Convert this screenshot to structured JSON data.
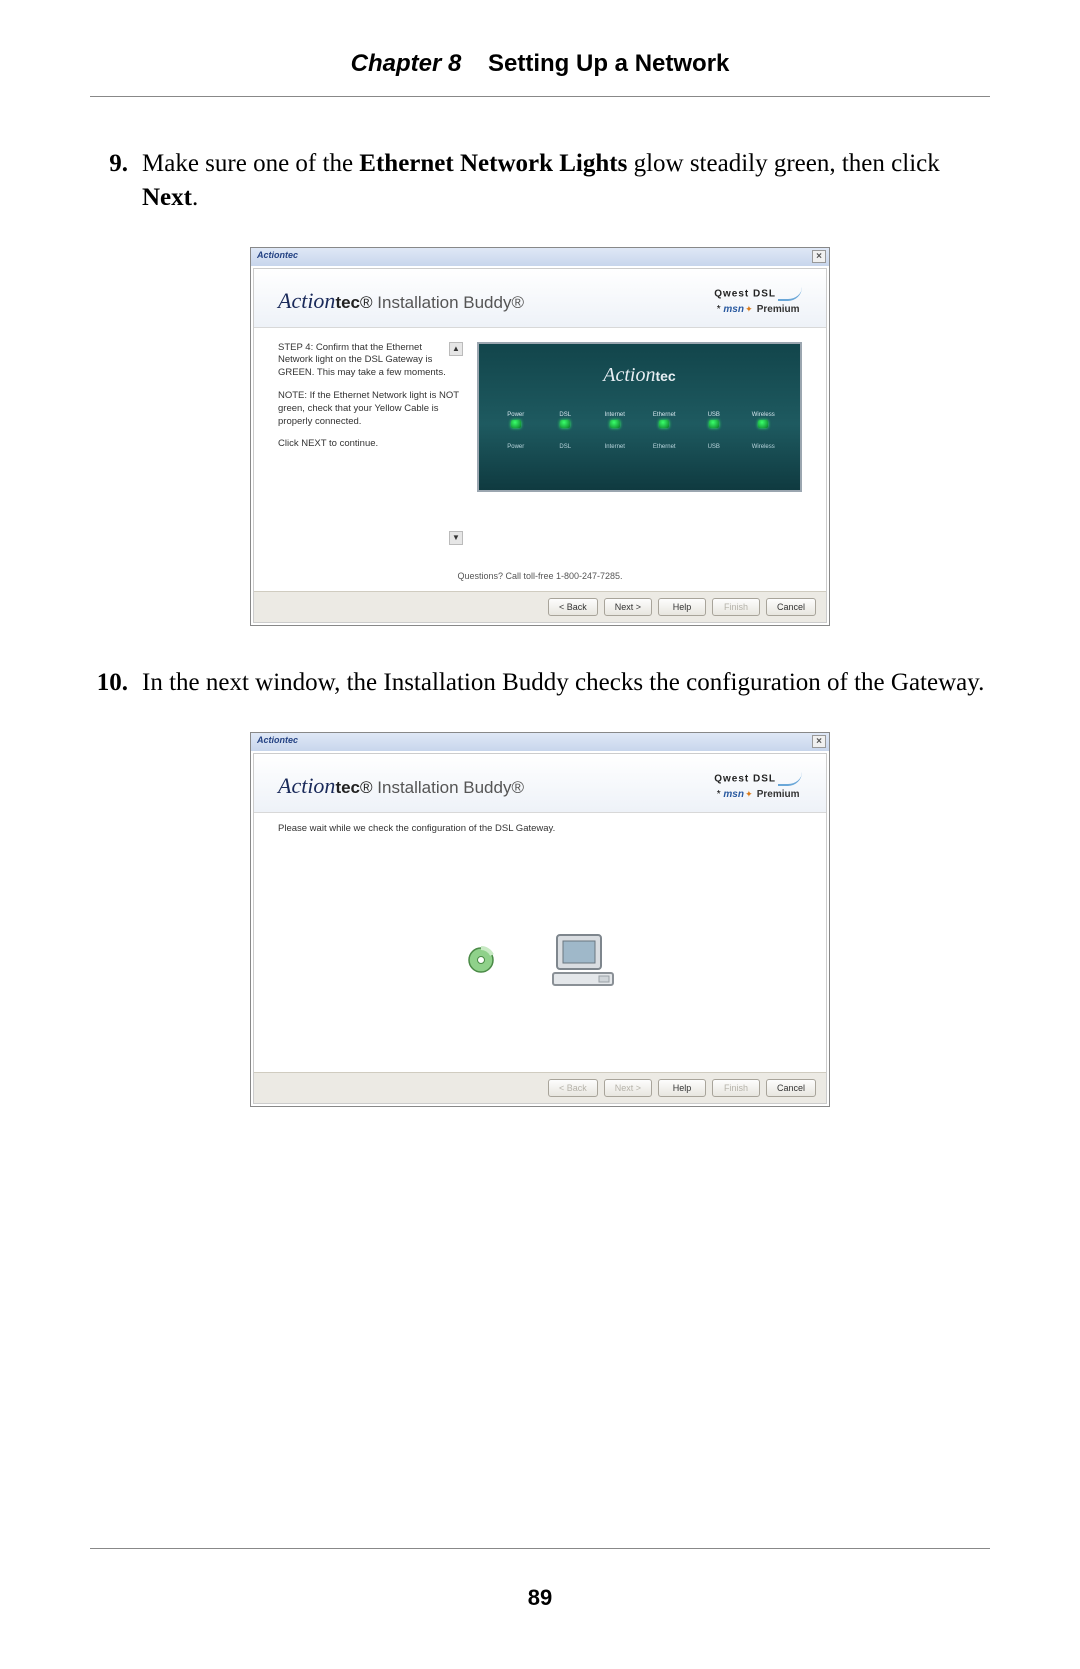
{
  "header": {
    "chapter_label": "Chapter 8",
    "chapter_title": "Setting Up a Network"
  },
  "steps": {
    "s9": {
      "num": "9.",
      "text_pre": "Make sure one of the ",
      "text_bold1": "Ethernet Network Lights",
      "text_mid": " glow steadily green, then click ",
      "text_bold2": "Next",
      "text_post": "."
    },
    "s10": {
      "num": "10.",
      "text": "In the next window, the Installation Buddy checks the configuration of the Gateway."
    }
  },
  "dialog_common": {
    "titlebar": "Actiontec",
    "close_glyph": "×",
    "logo_action": "Action",
    "logo_tec": "tec",
    "logo_reg": "®",
    "logo_ib": " Installation Buddy®",
    "qwest": "Qwest DSL",
    "msn": "msn",
    "premium": " Premium",
    "questions": "Questions? Call toll-free 1-800-247-7285.",
    "btn_back": "< Back",
    "btn_next": "Next >",
    "btn_help": "Help",
    "btn_finish": "Finish",
    "btn_cancel": "Cancel"
  },
  "dialog1": {
    "p1": "STEP 4: Confirm that the Ethernet Network light on the DSL Gateway is GREEN.  This may take a few moments.",
    "p2": "NOTE:  If the Ethernet Network light is NOT green, check that your Yellow Cable is properly connected.",
    "p3": "Click NEXT to continue.",
    "device_brand_a": "Action",
    "device_brand_b": "tec",
    "lights": [
      "Power",
      "DSL",
      "Internet",
      "Ethernet",
      "USB",
      "Wireless"
    ],
    "labels": [
      "Power",
      "DSL",
      "Internet",
      "Ethernet",
      "USB",
      "Wireless"
    ]
  },
  "dialog2": {
    "p1": "Please wait while we check the configuration of the DSL Gateway."
  },
  "page_number": "89"
}
